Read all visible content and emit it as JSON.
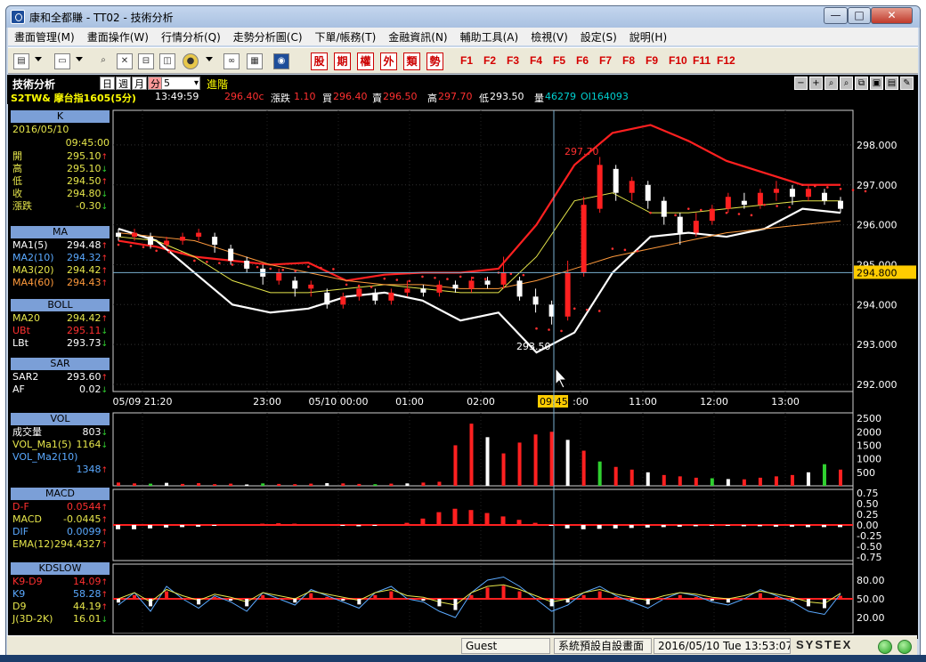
{
  "window": {
    "title": "康和全都賺 - TT02 - 技術分析",
    "min": "—",
    "max": "□",
    "close": "✕"
  },
  "menu": [
    "畫面管理(M)",
    "畫面操作(W)",
    "行情分析(Q)",
    "走勢分析圖(C)",
    "下單/帳務(T)",
    "金融資訊(N)",
    "輔助工具(A)",
    "檢視(V)",
    "設定(S)",
    "說明(H)"
  ],
  "toolbar": {
    "icons": [
      "window-layout-icon",
      "monitor-icon",
      "search-icon",
      "close-box-icon",
      "layout-icon",
      "split-icon",
      "coin-icon",
      "link-icon",
      "note-icon",
      "logo-icon"
    ],
    "categories": [
      "股",
      "期",
      "權",
      "外",
      "類",
      "勢"
    ],
    "function_keys": [
      "F1",
      "F2",
      "F3",
      "F4",
      "F5",
      "F6",
      "F7",
      "F8",
      "F9",
      "F10",
      "F11",
      "F12"
    ]
  },
  "chart_header": {
    "module": "技術分析",
    "periods": [
      "日",
      "週",
      "月",
      "分"
    ],
    "active_period": "分",
    "period_value": "5",
    "advanced": "進階",
    "tools": [
      "−",
      "+",
      "⌕",
      "⌕",
      "⧉",
      "▣",
      "▤",
      "✎"
    ]
  },
  "quote": {
    "symbol": "S2TW& 摩台指1605(5分)",
    "time": "13:49:59",
    "last": "296.40c",
    "change_label": "漲跌",
    "change": "1.10",
    "bid_label": "買",
    "bid": "296.40",
    "ask_label": "賣",
    "ask": "296.50",
    "high_label": "高",
    "high": "297.70",
    "low_label": "低",
    "low": "293.50",
    "vol_label": "量",
    "vol": "46279",
    "oi": "OI164093"
  },
  "side": {
    "k": {
      "head": "K",
      "date": "2016/05/10",
      "time": "09:45:00",
      "rows": [
        {
          "label": "開",
          "value": "295.10",
          "arrow": "↑"
        },
        {
          "label": "高",
          "value": "295.10",
          "arrow": "↓"
        },
        {
          "label": "低",
          "value": "294.50",
          "arrow": "↑"
        },
        {
          "label": "收",
          "value": "294.80",
          "arrow": "↓"
        },
        {
          "label": "漲跌",
          "value": "-0.30",
          "arrow": "↓"
        }
      ]
    },
    "ma": {
      "head": "MA",
      "rows": [
        {
          "label": "MA1(5)",
          "value": "294.48",
          "arrow": "↑",
          "color": "#ffffff"
        },
        {
          "label": "MA2(10)",
          "value": "294.32",
          "arrow": "↑",
          "color": "#5aa9ff"
        },
        {
          "label": "MA3(20)",
          "value": "294.42",
          "arrow": "↑",
          "color": "#e6e64b"
        },
        {
          "label": "MA4(60)",
          "value": "294.43",
          "arrow": "↑",
          "color": "#ff9a3c"
        }
      ]
    },
    "boll": {
      "head": "BOLL",
      "rows": [
        {
          "label": "MA20",
          "value": "294.42",
          "arrow": "↑",
          "color": "#e6e64b"
        },
        {
          "label": "UBt",
          "value": "295.11",
          "arrow": "↓",
          "color": "#ff3030"
        },
        {
          "label": "LBt",
          "value": "293.73",
          "arrow": "↓",
          "color": "#ffffff"
        }
      ]
    },
    "sar": {
      "head": "SAR",
      "rows": [
        {
          "label": "SAR2",
          "value": "293.60",
          "arrow": "↑",
          "color": "#ffffff"
        },
        {
          "label": "AF",
          "value": "0.02",
          "arrow": "↓",
          "color": "#ffffff"
        }
      ]
    },
    "vol": {
      "head": "VOL",
      "rows": [
        {
          "label": "成交量",
          "value": "803",
          "arrow": "↓",
          "color": "#ffffff"
        },
        {
          "label": "VOL_Ma1(5)",
          "value": "1164",
          "arrow": "↓",
          "color": "#e6e64b"
        },
        {
          "label": "VOL_Ma2(10)",
          "value": "",
          "arrow": "",
          "color": "#5aa9ff"
        },
        {
          "label": "",
          "value": "1348",
          "arrow": "↑",
          "color": "#5aa9ff"
        }
      ]
    },
    "macd": {
      "head": "MACD",
      "rows": [
        {
          "label": "D-F",
          "value": "0.0544",
          "arrow": "↑",
          "color": "#ff3030"
        },
        {
          "label": "MACD",
          "value": "-0.0445",
          "arrow": "↑",
          "color": "#e6e64b"
        },
        {
          "label": "DIF",
          "value": "0.0099",
          "arrow": "↑",
          "color": "#5aa9ff"
        },
        {
          "label": "EMA(12)",
          "value": "294.4327",
          "arrow": "↑",
          "color": "#e6e64b"
        }
      ]
    },
    "kd": {
      "head": "KDSLOW",
      "rows": [
        {
          "label": "K9-D9",
          "value": "14.09",
          "arrow": "↑",
          "color": "#ff3030"
        },
        {
          "label": "K9",
          "value": "58.28",
          "arrow": "↑",
          "color": "#5aa9ff"
        },
        {
          "label": "D9",
          "value": "44.19",
          "arrow": "↑",
          "color": "#e6e64b"
        },
        {
          "label": "J(3D-2K)",
          "value": "16.01",
          "arrow": "↓",
          "color": "#e6e64b"
        }
      ]
    }
  },
  "axes": {
    "price_ticks": [
      "298.000",
      "297.000",
      "296.000",
      "295.000",
      "294.000",
      "293.000",
      "292.000"
    ],
    "price_marker": "294.800",
    "time_ticks": [
      "05/09 21:20",
      "23:00",
      "05/10 00:00",
      "01:00",
      "02:00",
      "09:45",
      ":00",
      "11:00",
      "12:00",
      "13:00"
    ],
    "vol_ticks": [
      "2500",
      "2000",
      "1500",
      "1000",
      "500"
    ],
    "macd_ticks": [
      "0.75",
      "0.50",
      "0.25",
      "0.00",
      "-0.25",
      "-0.50",
      "-0.75"
    ],
    "kd_ticks": [
      "80.00",
      "50.00",
      "20.00"
    ],
    "high_annotation": "297.70",
    "low_annotation": "293.50",
    "cursor_label": "09:45"
  },
  "chart_data": {
    "type": "line",
    "title": "摩台指1605(5分)",
    "y_range": [
      292.0,
      298.6
    ],
    "series": [
      {
        "name": "UBt",
        "color": "#ff2020",
        "values": [
          295.6,
          295.45,
          295.2,
          295.1,
          295.0,
          295.05,
          294.6,
          294.75,
          294.8,
          294.8,
          294.9,
          296.0,
          297.5,
          298.3,
          298.5,
          298.1,
          297.6,
          297.3,
          297.0,
          297.0
        ]
      },
      {
        "name": "LBt",
        "color": "#ffffff",
        "values": [
          295.9,
          295.6,
          294.8,
          294.0,
          293.8,
          293.9,
          294.2,
          294.3,
          294.1,
          293.6,
          293.8,
          292.8,
          293.3,
          294.8,
          295.7,
          295.8,
          295.7,
          295.9,
          296.4,
          296.3
        ]
      },
      {
        "name": "MA20",
        "color": "#e6e64b",
        "values": [
          295.7,
          295.6,
          295.2,
          294.6,
          294.3,
          294.3,
          294.4,
          294.5,
          294.4,
          294.3,
          294.3,
          295.2,
          296.6,
          296.8,
          296.3,
          296.3,
          296.4,
          296.5,
          296.6,
          296.6
        ]
      },
      {
        "name": "MA4(60)",
        "color": "#ff9a3c",
        "values": [
          295.8,
          295.7,
          295.6,
          295.3,
          295.0,
          294.8,
          294.6,
          294.5,
          294.5,
          294.4,
          294.4,
          294.6,
          294.9,
          295.2,
          295.4,
          295.6,
          295.8,
          295.9,
          296.0,
          296.1
        ]
      }
    ],
    "candles": [
      {
        "o": 295.8,
        "c": 295.7,
        "h": 295.9,
        "l": 295.6
      },
      {
        "o": 295.7,
        "c": 295.8,
        "h": 295.9,
        "l": 295.6
      },
      {
        "o": 295.7,
        "c": 295.5,
        "h": 295.8,
        "l": 295.4
      },
      {
        "o": 295.5,
        "c": 295.6,
        "h": 295.7,
        "l": 295.4
      },
      {
        "o": 295.6,
        "c": 295.7,
        "h": 295.8,
        "l": 295.5
      },
      {
        "o": 295.7,
        "c": 295.8,
        "h": 295.9,
        "l": 295.6
      },
      {
        "o": 295.7,
        "c": 295.5,
        "h": 295.8,
        "l": 295.3
      },
      {
        "o": 295.4,
        "c": 295.1,
        "h": 295.5,
        "l": 295.0
      },
      {
        "o": 295.1,
        "c": 294.9,
        "h": 295.2,
        "l": 294.8
      },
      {
        "o": 294.9,
        "c": 294.7,
        "h": 295.0,
        "l": 294.5
      },
      {
        "o": 294.6,
        "c": 294.8,
        "h": 294.9,
        "l": 294.5
      },
      {
        "o": 294.6,
        "c": 294.4,
        "h": 294.7,
        "l": 294.2
      },
      {
        "o": 294.4,
        "c": 294.5,
        "h": 294.6,
        "l": 294.2
      },
      {
        "o": 294.3,
        "c": 294.0,
        "h": 294.4,
        "l": 293.9
      },
      {
        "o": 294.0,
        "c": 294.2,
        "h": 294.3,
        "l": 293.9
      },
      {
        "o": 294.2,
        "c": 294.4,
        "h": 294.5,
        "l": 294.1
      },
      {
        "o": 294.3,
        "c": 294.1,
        "h": 294.4,
        "l": 294.0
      },
      {
        "o": 294.1,
        "c": 294.3,
        "h": 294.4,
        "l": 294.0
      },
      {
        "o": 294.3,
        "c": 294.4,
        "h": 294.6,
        "l": 294.2
      },
      {
        "o": 294.4,
        "c": 294.3,
        "h": 294.5,
        "l": 294.2
      },
      {
        "o": 294.3,
        "c": 294.5,
        "h": 294.6,
        "l": 294.2
      },
      {
        "o": 294.5,
        "c": 294.4,
        "h": 294.6,
        "l": 294.3
      },
      {
        "o": 294.4,
        "c": 294.6,
        "h": 294.7,
        "l": 294.3
      },
      {
        "o": 294.6,
        "c": 294.5,
        "h": 294.7,
        "l": 294.4
      },
      {
        "o": 294.5,
        "c": 294.8,
        "h": 295.2,
        "l": 294.4
      },
      {
        "o": 294.6,
        "c": 294.2,
        "h": 294.7,
        "l": 294.1
      },
      {
        "o": 294.2,
        "c": 294.0,
        "h": 294.4,
        "l": 293.8
      },
      {
        "o": 294.0,
        "c": 293.7,
        "h": 294.1,
        "l": 293.5
      },
      {
        "o": 293.7,
        "c": 294.8,
        "h": 295.1,
        "l": 293.6
      },
      {
        "o": 294.8,
        "c": 296.5,
        "h": 296.7,
        "l": 294.7
      },
      {
        "o": 296.4,
        "c": 297.5,
        "h": 297.7,
        "l": 296.3
      },
      {
        "o": 297.4,
        "c": 296.8,
        "h": 297.5,
        "l": 296.6
      },
      {
        "o": 296.8,
        "c": 297.1,
        "h": 297.2,
        "l": 296.6
      },
      {
        "o": 297.0,
        "c": 296.6,
        "h": 297.1,
        "l": 296.4
      },
      {
        "o": 296.6,
        "c": 296.2,
        "h": 296.7,
        "l": 296.0
      },
      {
        "o": 296.2,
        "c": 295.8,
        "h": 296.3,
        "l": 295.5
      },
      {
        "o": 295.8,
        "c": 296.1,
        "h": 296.3,
        "l": 295.7
      },
      {
        "o": 296.1,
        "c": 296.4,
        "h": 296.5,
        "l": 296.0
      },
      {
        "o": 296.4,
        "c": 296.7,
        "h": 296.8,
        "l": 296.3
      },
      {
        "o": 296.6,
        "c": 296.5,
        "h": 296.8,
        "l": 296.4
      },
      {
        "o": 296.5,
        "c": 296.8,
        "h": 296.9,
        "l": 296.4
      },
      {
        "o": 296.8,
        "c": 296.9,
        "h": 297.1,
        "l": 296.6
      },
      {
        "o": 296.9,
        "c": 296.7,
        "h": 297.0,
        "l": 296.5
      },
      {
        "o": 296.7,
        "c": 296.9,
        "h": 297.0,
        "l": 296.6
      },
      {
        "o": 296.8,
        "c": 296.6,
        "h": 296.9,
        "l": 296.5
      },
      {
        "o": 296.6,
        "c": 296.4,
        "h": 296.7,
        "l": 296.3
      }
    ],
    "volume": [
      120,
      90,
      80,
      110,
      70,
      100,
      60,
      80,
      50,
      90,
      70,
      60,
      80,
      100,
      90,
      70,
      60,
      80,
      90,
      120,
      150,
      1500,
      2300,
      1800,
      1200,
      1600,
      1900,
      2000,
      1700,
      1300,
      900,
      700,
      600,
      500,
      400,
      350,
      300,
      280,
      250,
      240,
      300,
      350,
      400,
      500,
      800,
      600
    ],
    "macd_hist": [
      -0.1,
      -0.1,
      -0.08,
      -0.06,
      -0.05,
      -0.04,
      -0.02,
      0.0,
      0.02,
      0.03,
      0.04,
      0.03,
      0.02,
      0.0,
      -0.02,
      -0.03,
      -0.02,
      0.0,
      0.05,
      0.15,
      0.3,
      0.38,
      0.35,
      0.28,
      0.2,
      0.12,
      0.05,
      -0.02,
      -0.08,
      -0.1,
      -0.09,
      -0.08,
      -0.07,
      -0.06,
      -0.05,
      -0.04,
      -0.03,
      -0.02,
      -0.02,
      -0.03,
      -0.03,
      -0.04,
      -0.04,
      -0.05,
      -0.05,
      -0.05
    ],
    "kd_k": [
      40,
      60,
      30,
      70,
      50,
      35,
      55,
      45,
      30,
      60,
      50,
      40,
      65,
      55,
      45,
      35,
      60,
      70,
      50,
      45,
      30,
      20,
      60,
      80,
      85,
      70,
      50,
      30,
      40,
      60,
      70,
      55,
      45,
      35,
      50,
      60,
      55,
      45,
      40,
      50,
      65,
      55,
      45,
      30,
      25,
      58
    ]
  },
  "status": {
    "user": "Guest",
    "layout": "系統預設自設畫面",
    "datetime": "2016/05/10 Tue 13:53:07",
    "brand": "SYSTEX"
  }
}
